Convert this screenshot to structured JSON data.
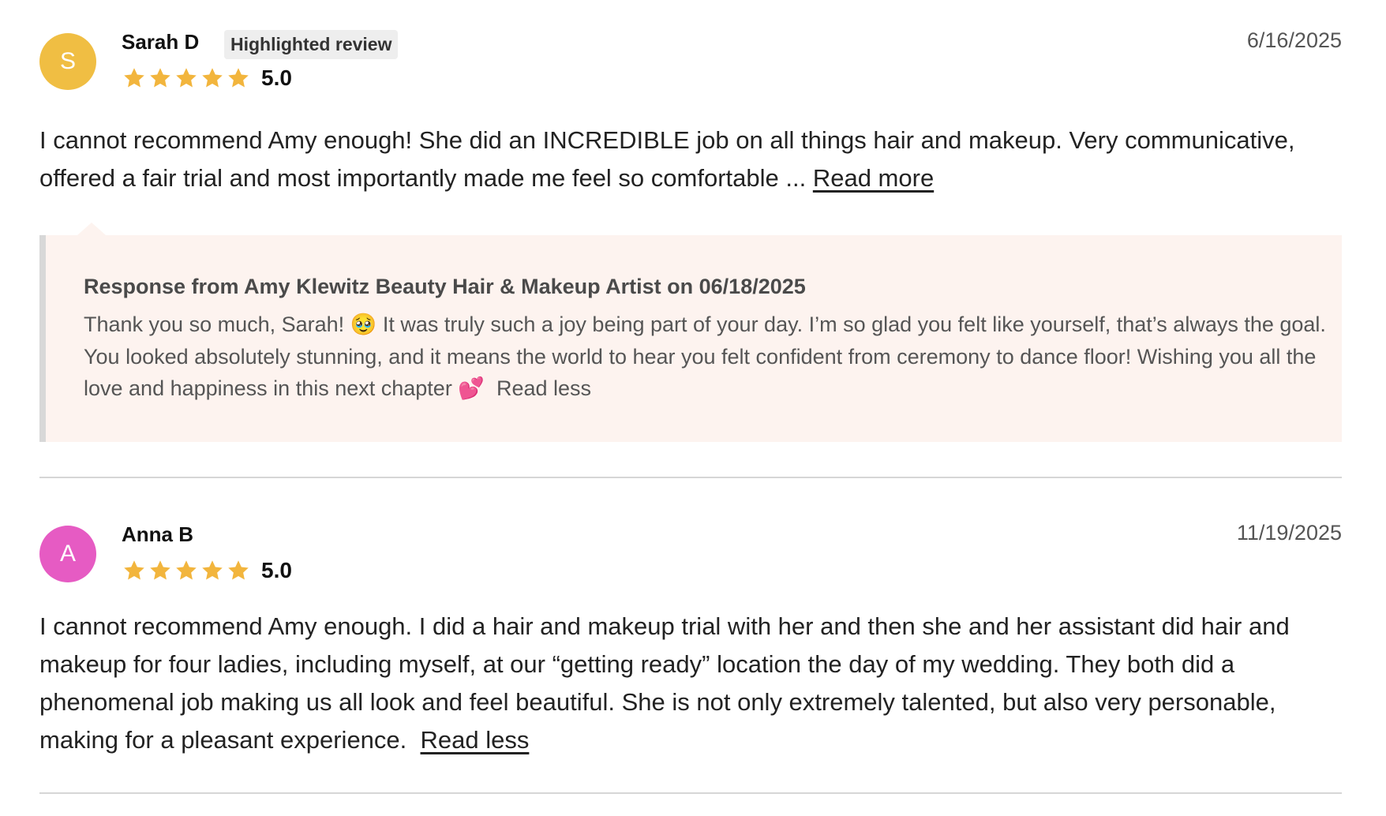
{
  "reviews": [
    {
      "avatar_letter": "S",
      "avatar_color": "#F0BE43",
      "name": "Sarah D",
      "badge": "Highlighted review",
      "rating": "5.0",
      "stars": 5,
      "date": "6/16/2025",
      "text": "I cannot recommend Amy enough! She did an INCREDIBLE job on all things hair and makeup. Very communicative, offered a fair trial and most importantly made me feel so comfortable ...",
      "toggle_label": "Read more",
      "response": {
        "title": "Response from Amy Klewitz Beauty Hair & Makeup Artist on 06/18/2025",
        "text_before_emoji": "Thank you so much, Sarah!",
        "emoji_1": "🥹",
        "text_middle": "It was truly such a joy being part of your day. I’m so glad you felt like yourself, that’s always the goal. You looked absolutely stunning, and it means the world to hear you felt confident from ceremony to dance floor! Wishing you all the love and happiness in this next chapter",
        "emoji_2": "💕",
        "toggle_label": "Read less"
      }
    },
    {
      "avatar_letter": "A",
      "avatar_color": "#E65BC3",
      "name": "Anna B",
      "rating": "5.0",
      "stars": 5,
      "date": "11/19/2025",
      "text": "I cannot recommend Amy enough. I did a hair and makeup trial with her and then she and her assistant did hair and makeup for four ladies, including myself, at our “getting ready” location the day of my wedding. They both did a phenomenal job making us all look and feel beautiful. She is not only extremely talented, but also very personable, making for a pleasant experience.",
      "toggle_label": "Read less"
    }
  ],
  "colors": {
    "star": "#F2B53D",
    "response_bg": "#FDF3EF"
  }
}
